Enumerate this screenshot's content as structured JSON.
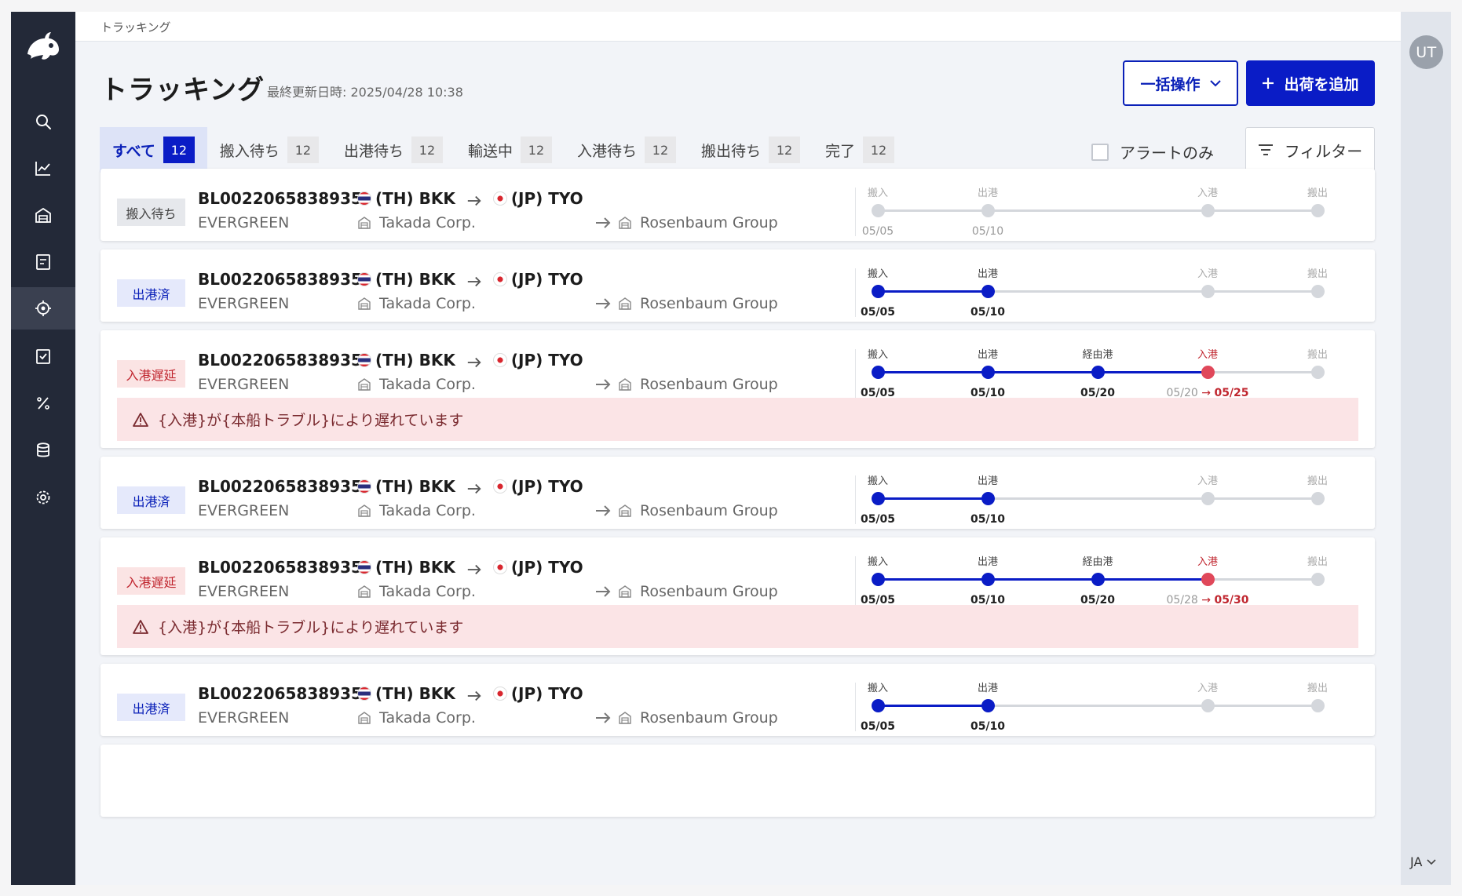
{
  "breadcrumb": "トラッキング",
  "page": {
    "title": "トラッキング",
    "last_updated": "最終更新日時: 2025/04/28 10:38"
  },
  "actions": {
    "bulk_label": "一括操作",
    "add_label": "出荷を追加",
    "alert_only_label": "アラートのみ",
    "filter_label": "フィルター"
  },
  "tabs": [
    {
      "label": "すべて",
      "count": "12"
    },
    {
      "label": "搬入待ち",
      "count": "12"
    },
    {
      "label": "出港待ち",
      "count": "12"
    },
    {
      "label": "輸送中",
      "count": "12"
    },
    {
      "label": "入港待ち",
      "count": "12"
    },
    {
      "label": "搬出待ち",
      "count": "12"
    },
    {
      "label": "完了",
      "count": "12"
    }
  ],
  "user": {
    "initials": "UT",
    "language": "JA"
  },
  "colors": {
    "primary": "#0a1cc6",
    "track_done": "#0a1cc6",
    "track_pending": "#d4d7dc",
    "delay": "#e0485a",
    "delay_bg": "#fbe4e6"
  },
  "nav_icons": [
    "search-icon",
    "analytics-icon",
    "warehouse-icon",
    "booking-icon",
    "tracking-icon",
    "task-icon",
    "tariff-icon",
    "database-icon",
    "settings-icon"
  ],
  "shipments": [
    {
      "status": "搬入待ち",
      "status_kind": "waiting",
      "bl": "BL0022065838935",
      "carrier": "EVERGREEN",
      "origin": "(TH) BKK",
      "destination": "(JP) TYO",
      "shipper": "Takada Corp.",
      "consignee": "Rosenbaum Group",
      "alert": null,
      "stages": [
        {
          "label": "搬入",
          "pos": 0,
          "state": "pending",
          "date": "05/05"
        },
        {
          "label": "出港",
          "pos": 1,
          "state": "pending",
          "date": "05/10"
        },
        {
          "label": "入港",
          "pos": 3,
          "state": "pending",
          "date": ""
        },
        {
          "label": "搬出",
          "pos": 4,
          "state": "pending",
          "date": ""
        }
      ]
    },
    {
      "status": "出港済",
      "status_kind": "departed",
      "bl": "BL0022065838935",
      "carrier": "EVERGREEN",
      "origin": "(TH) BKK",
      "destination": "(JP) TYO",
      "shipper": "Takada Corp.",
      "consignee": "Rosenbaum Group",
      "alert": null,
      "stages": [
        {
          "label": "搬入",
          "pos": 0,
          "state": "done",
          "date": "05/05"
        },
        {
          "label": "出港",
          "pos": 1,
          "state": "done",
          "date": "05/10"
        },
        {
          "label": "入港",
          "pos": 3,
          "state": "pending",
          "date": ""
        },
        {
          "label": "搬出",
          "pos": 4,
          "state": "pending",
          "date": ""
        }
      ]
    },
    {
      "status": "入港遅延",
      "status_kind": "delayed",
      "bl": "BL0022065838935",
      "carrier": "EVERGREEN",
      "origin": "(TH) BKK",
      "destination": "(JP) TYO",
      "shipper": "Takada Corp.",
      "consignee": "Rosenbaum Group",
      "alert": "{入港}が{本船トラブル}により遅れています",
      "stages": [
        {
          "label": "搬入",
          "pos": 0,
          "state": "done",
          "date": "05/05"
        },
        {
          "label": "出港",
          "pos": 1,
          "state": "done",
          "date": "05/10"
        },
        {
          "label": "経由港",
          "pos": 2,
          "state": "done",
          "date": "05/20"
        },
        {
          "label": "入港",
          "pos": 3,
          "state": "delayed",
          "date": "05/20",
          "new_date": "05/25"
        },
        {
          "label": "搬出",
          "pos": 4,
          "state": "pending",
          "date": ""
        }
      ]
    },
    {
      "status": "出港済",
      "status_kind": "departed",
      "bl": "BL0022065838935",
      "carrier": "EVERGREEN",
      "origin": "(TH) BKK",
      "destination": "(JP) TYO",
      "shipper": "Takada Corp.",
      "consignee": "Rosenbaum Group",
      "alert": null,
      "stages": [
        {
          "label": "搬入",
          "pos": 0,
          "state": "done",
          "date": "05/05"
        },
        {
          "label": "出港",
          "pos": 1,
          "state": "done",
          "date": "05/10"
        },
        {
          "label": "入港",
          "pos": 3,
          "state": "pending",
          "date": ""
        },
        {
          "label": "搬出",
          "pos": 4,
          "state": "pending",
          "date": ""
        }
      ]
    },
    {
      "status": "入港遅延",
      "status_kind": "delayed",
      "bl": "BL0022065838935",
      "carrier": "EVERGREEN",
      "origin": "(TH) BKK",
      "destination": "(JP) TYO",
      "shipper": "Takada Corp.",
      "consignee": "Rosenbaum Group",
      "alert": "{入港}が{本船トラブル}により遅れています",
      "stages": [
        {
          "label": "搬入",
          "pos": 0,
          "state": "done",
          "date": "05/05"
        },
        {
          "label": "出港",
          "pos": 1,
          "state": "done",
          "date": "05/10"
        },
        {
          "label": "経由港",
          "pos": 2,
          "state": "done",
          "date": "05/20"
        },
        {
          "label": "入港",
          "pos": 3,
          "state": "delayed",
          "date": "05/28",
          "new_date": "05/30"
        },
        {
          "label": "搬出",
          "pos": 4,
          "state": "pending",
          "date": ""
        }
      ]
    },
    {
      "status": "出港済",
      "status_kind": "departed",
      "bl": "BL0022065838935",
      "carrier": "EVERGREEN",
      "origin": "(TH) BKK",
      "destination": "(JP) TYO",
      "shipper": "Takada Corp.",
      "consignee": "Rosenbaum Group",
      "alert": null,
      "stages": [
        {
          "label": "搬入",
          "pos": 0,
          "state": "done",
          "date": "05/05"
        },
        {
          "label": "出港",
          "pos": 1,
          "state": "done",
          "date": "05/10"
        },
        {
          "label": "入港",
          "pos": 3,
          "state": "pending",
          "date": ""
        },
        {
          "label": "搬出",
          "pos": 4,
          "state": "pending",
          "date": ""
        }
      ]
    },
    {
      "status": "",
      "status_kind": "waiting",
      "bl": "",
      "carrier": "",
      "origin": "",
      "destination": "",
      "shipper": "",
      "consignee": "",
      "alert": null,
      "stages": []
    }
  ]
}
